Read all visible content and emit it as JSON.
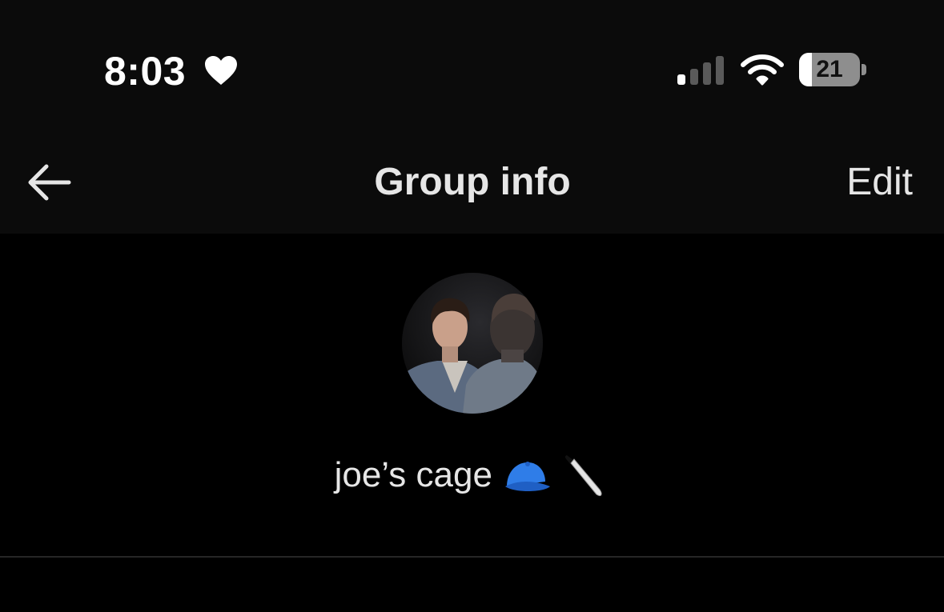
{
  "status_bar": {
    "time": "8:03",
    "battery_level": "21",
    "battery_fraction": 0.21,
    "signal_bars_active": 1,
    "signal_bars_total": 4,
    "icons": [
      "heart-icon",
      "cellular-signal-icon",
      "wifi-icon",
      "battery-icon"
    ]
  },
  "header": {
    "back_icon": "back-arrow-icon",
    "title": "Group info",
    "edit_label": "Edit"
  },
  "group": {
    "name": "joe’s cage",
    "emoji": [
      "cap-emoji",
      "knife-emoji"
    ]
  },
  "colors": {
    "background": "#000000",
    "header_background": "#0b0b0b",
    "text": "#e6e6e6",
    "emoji_cap": "#2f7de8",
    "divider": "#262626"
  }
}
